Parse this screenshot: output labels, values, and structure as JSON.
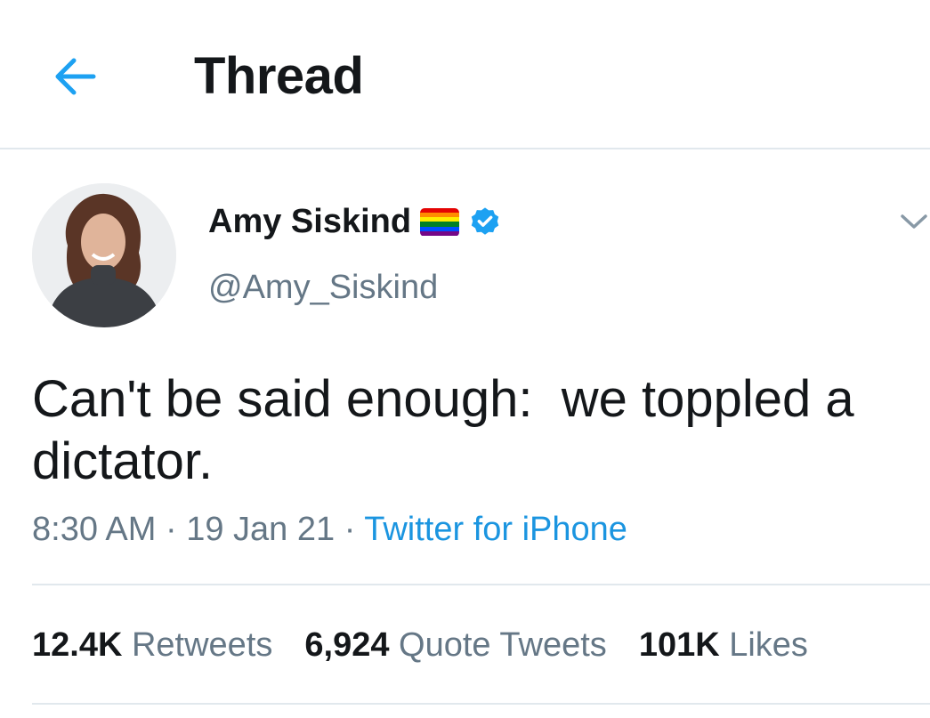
{
  "header": {
    "back_icon": "arrow-left-icon",
    "title": "Thread"
  },
  "tweet": {
    "author": {
      "display_name": "Amy Siskind",
      "handle": "@Amy_Siskind",
      "flag_icon": "rainbow-flag-icon",
      "verified_icon": "verified-badge-icon"
    },
    "more_icon": "chevron-down-icon",
    "text": "Can't be said enough:  we toppled a dictator.",
    "time": "8:30 AM",
    "date": "19 Jan 21",
    "separator": "·",
    "source": "Twitter for iPhone",
    "stats": {
      "retweets_count": "12.4K",
      "retweets_label": "Retweets",
      "quotes_count": "6,924",
      "quotes_label": "Quote Tweets",
      "likes_count": "101K",
      "likes_label": "Likes"
    }
  },
  "colors": {
    "accent": "#1da1f2",
    "link": "#1b95e0",
    "secondary_text": "#657786",
    "primary_text": "#14171a",
    "divider": "#e1e8ed"
  }
}
